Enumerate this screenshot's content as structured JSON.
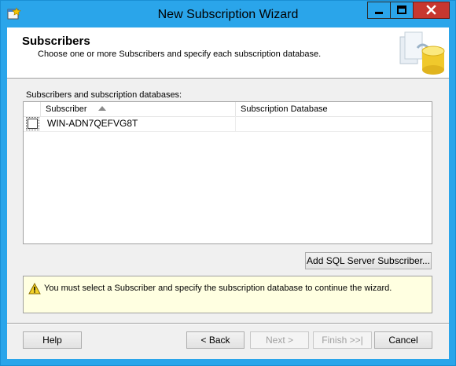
{
  "window": {
    "title": "New Subscription Wizard",
    "minimize_label": "minimize",
    "maximize_label": "maximize",
    "close_label": "close"
  },
  "header": {
    "title": "Subscribers",
    "subtitle": "Choose one or more Subscribers and specify each subscription database."
  },
  "list": {
    "label": "Subscribers and subscription databases:",
    "columns": [
      "Subscriber",
      "Subscription Database"
    ],
    "sort": {
      "column": "Subscriber",
      "direction": "ascending"
    },
    "rows": [
      {
        "checked": false,
        "subscriber": "WIN-ADN7QEFVG8T",
        "database": ""
      }
    ]
  },
  "buttons": {
    "add_subscriber": "Add SQL Server Subscriber...",
    "help": "Help",
    "back": "< Back",
    "next": "Next >",
    "finish": "Finish >>|",
    "cancel": "Cancel"
  },
  "warning": {
    "text": "You must select a Subscriber and specify the subscription database to continue the wizard."
  },
  "icons": {
    "app": "wizard-app-icon",
    "header": "database-publication-icon",
    "warning": "warning-triangle-icon"
  },
  "colors": {
    "titlebar": "#2aa5ea",
    "close_button": "#c7372f",
    "dialog_background": "#f0f0f0",
    "warning_background": "#ffffe1"
  }
}
